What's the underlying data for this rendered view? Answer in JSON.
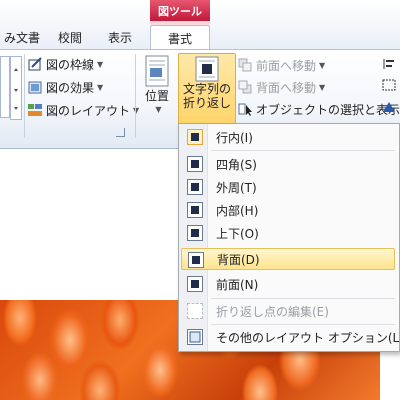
{
  "context_tab_header": "図ツール",
  "tabs": [
    {
      "label": "み文書"
    },
    {
      "label": "校閲"
    },
    {
      "label": "表示"
    },
    {
      "label": "書式"
    }
  ],
  "ribbon": {
    "picture_border": "図の枠線",
    "picture_effects": "図の効果",
    "picture_layout": "図のレイアウト",
    "position": "位置",
    "wrap_text_line1": "文字列の",
    "wrap_text_line2": "折り返し",
    "bring_forward": "前面へ移動",
    "send_backward": "背面へ移動",
    "selection_pane": "オブジェクトの選択と表示"
  },
  "menu": {
    "items": [
      {
        "label": "行内(I)"
      },
      {
        "label": "四角(S)"
      },
      {
        "label": "外周(T)"
      },
      {
        "label": "内部(H)"
      },
      {
        "label": "上下(O)"
      },
      {
        "label": "背面(D)"
      },
      {
        "label": "前面(N)"
      },
      {
        "label": "折り返し点の編集(E)"
      },
      {
        "label": "その他のレイアウト オプション(L)..."
      }
    ]
  },
  "colors": {
    "context_tab": "#c2183a",
    "highlight": "#ffe48e",
    "ribbon_border": "#b2c2d8"
  }
}
